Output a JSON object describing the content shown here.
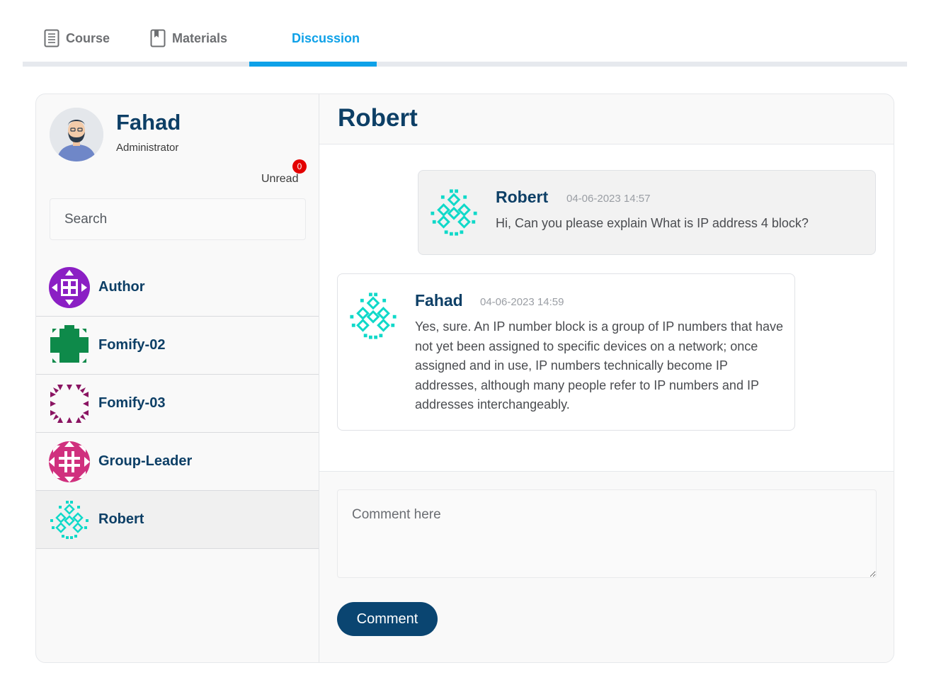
{
  "tabs": [
    {
      "label": "Course",
      "icon": "document-icon"
    },
    {
      "label": "Materials",
      "icon": "book-icon"
    },
    {
      "label": "Discussion",
      "active": true
    }
  ],
  "colors": {
    "accent": "#0ea1e8",
    "brand": "#0d3f66",
    "button": "#0a4571",
    "badge": "#e30000"
  },
  "profile": {
    "name": "Fahad",
    "role": "Administrator",
    "unread_label": "Unread",
    "unread_count": "0"
  },
  "search": {
    "placeholder": "Search"
  },
  "contacts": [
    {
      "name": "Author",
      "avatar": "identicon-purple"
    },
    {
      "name": "Fomify-02",
      "avatar": "identicon-green"
    },
    {
      "name": "Fomify-03",
      "avatar": "identicon-plum"
    },
    {
      "name": "Group-Leader",
      "avatar": "identicon-pink"
    },
    {
      "name": "Robert",
      "avatar": "identicon-cyan",
      "active": true
    }
  ],
  "conversation": {
    "title": "Robert",
    "messages": [
      {
        "author": "Robert",
        "time": "04-06-2023 14:57",
        "text": "Hi, Can you please explain What is IP address 4 block?"
      },
      {
        "author": "Fahad",
        "time": "04-06-2023 14:59",
        "text": "Yes, sure. An IP number block is a group of IP numbers that have not yet been assigned to specific devices on a network; once assigned and in use, IP numbers technically become IP addresses, although many people refer to IP numbers and IP addresses interchangeably."
      }
    ]
  },
  "composer": {
    "placeholder": "Comment here",
    "button_label": "Comment"
  }
}
